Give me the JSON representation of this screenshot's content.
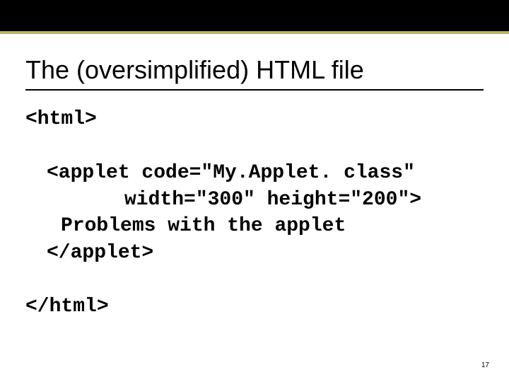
{
  "header": {
    "band_color": "#000000",
    "accent_color": "#b7b35a"
  },
  "title": "The (oversimplified) HTML file",
  "code": {
    "l1": "<html>",
    "l2": "<applet code=\"My.Applet. class\"",
    "l3": "width=\"300\" height=\"200\">",
    "l4": "Problems with the applet",
    "l5": "</applet>",
    "l6": "</html>"
  },
  "page_number": "17"
}
